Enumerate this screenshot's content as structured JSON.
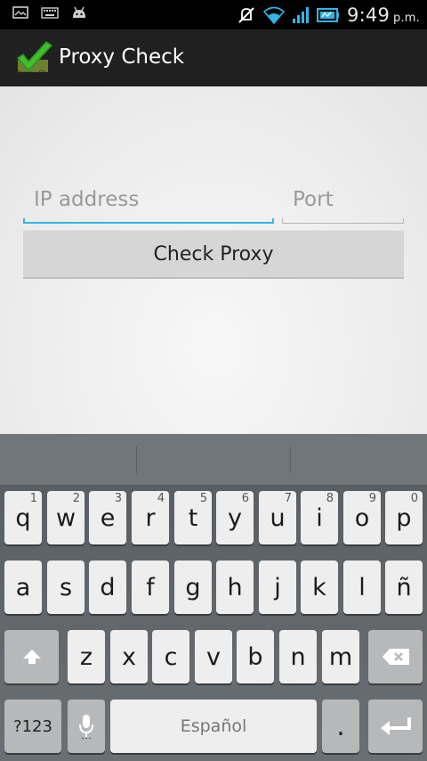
{
  "status_bar": {
    "left_icons": [
      "image-icon",
      "keyboard-icon",
      "android-icon"
    ],
    "right_icons": [
      "silent-icon",
      "wifi-icon",
      "signal-icon",
      "battery-icon"
    ],
    "time": "9:49",
    "ampm": "p.m."
  },
  "action_bar": {
    "title": "Proxy Check",
    "icon": "checkmark-app-icon"
  },
  "form": {
    "ip_placeholder": "IP address",
    "port_placeholder": "Port",
    "check_button": "Check Proxy"
  },
  "keyboard": {
    "row1": [
      {
        "label": "q",
        "hint": "1"
      },
      {
        "label": "w",
        "hint": "2"
      },
      {
        "label": "e",
        "hint": "3"
      },
      {
        "label": "r",
        "hint": "4"
      },
      {
        "label": "t",
        "hint": "5"
      },
      {
        "label": "y",
        "hint": "6"
      },
      {
        "label": "u",
        "hint": "7"
      },
      {
        "label": "i",
        "hint": "8"
      },
      {
        "label": "o",
        "hint": "9"
      },
      {
        "label": "p",
        "hint": "0"
      }
    ],
    "row2": [
      "a",
      "s",
      "d",
      "f",
      "g",
      "h",
      "j",
      "k",
      "l",
      "ñ"
    ],
    "row3": [
      "z",
      "x",
      "c",
      "v",
      "b",
      "n",
      "m"
    ],
    "symbols_label": "?123",
    "space_label": "Español",
    "period_label": "."
  },
  "colors": {
    "accent": "#33b5e5",
    "action_bar": "#202020",
    "keyboard_bg": "#5f6468"
  }
}
